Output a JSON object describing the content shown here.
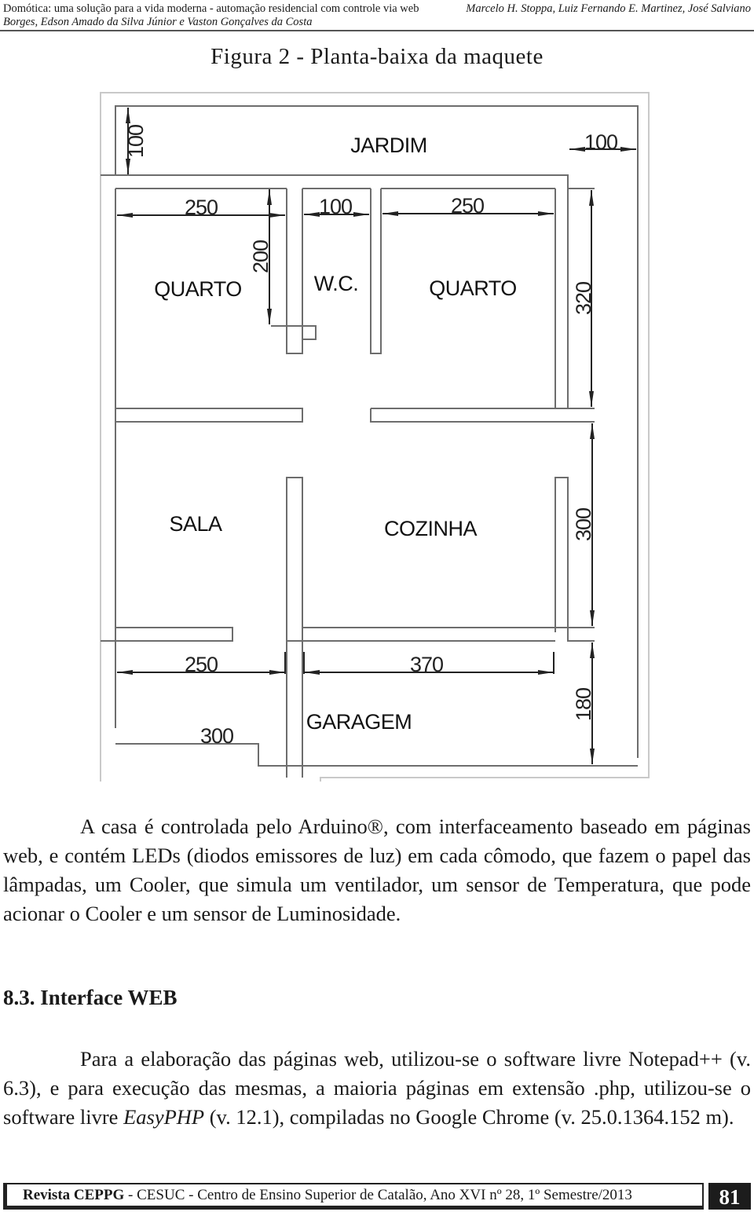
{
  "running_head": {
    "title_line": "Domótica: uma solução para a vida moderna - automação residencial com controle via web",
    "authors_line1": "Marcelo H. Stoppa, Luiz Fernando E. Martinez, José Salviano",
    "authors_line2": "Borges, Edson Amado da Silva Júnior e Vaston Gonçalves da Costa"
  },
  "figure": {
    "caption": "Figura 2 - Planta-baixa da maquete",
    "rooms": {
      "jardim": "JARDIM",
      "quarto_left": "QUARTO",
      "wc": "W.C.",
      "quarto_right": "QUARTO",
      "sala": "SALA",
      "cozinha": "COZINHA",
      "garagem": "GARAGEM"
    },
    "dimensions": {
      "jardim_height": "100",
      "jardim_right_width": "100",
      "quarto_left_width": "250",
      "wc_width": "100",
      "quarto_right_width": "250",
      "wc_wall_height": "200",
      "quarto_right_height": "320",
      "cozinha_height": "300",
      "sala_width": "250",
      "cozinha_width": "370",
      "garagem_height": "180",
      "garagem_width": "300"
    }
  },
  "paragraph1": "A casa é controlada pelo Arduino®, com interfaceamento baseado em páginas web, e contém LEDs (diodos emissores de luz) em cada cômodo, que fazem o papel das lâmpadas, um Cooler, que simula um ventilador, um sensor de Temperatura, que pode acionar o Cooler e um sensor de Luminosidade.",
  "section": {
    "heading": "8.3. Interface WEB"
  },
  "paragraph2": {
    "part1": "Para a elaboração das páginas web, utilizou-se o software livre Notepad++ (v. 6.3), e para execução das mesmas, a maioria páginas em extensão .php, utilizou-se o software livre ",
    "italic": "EasyPHP",
    "part2": " (v. 12.1), compiladas no Google Chrome (v. 25.0.1364.152 m)."
  },
  "footer": {
    "journal_bold": "Revista CEPPG",
    "journal_rest": " - CESUC - Centro de Ensino Superior de Catalão, Ano XVI nº 28, 1º Semestre/2013",
    "page_number": "81"
  }
}
